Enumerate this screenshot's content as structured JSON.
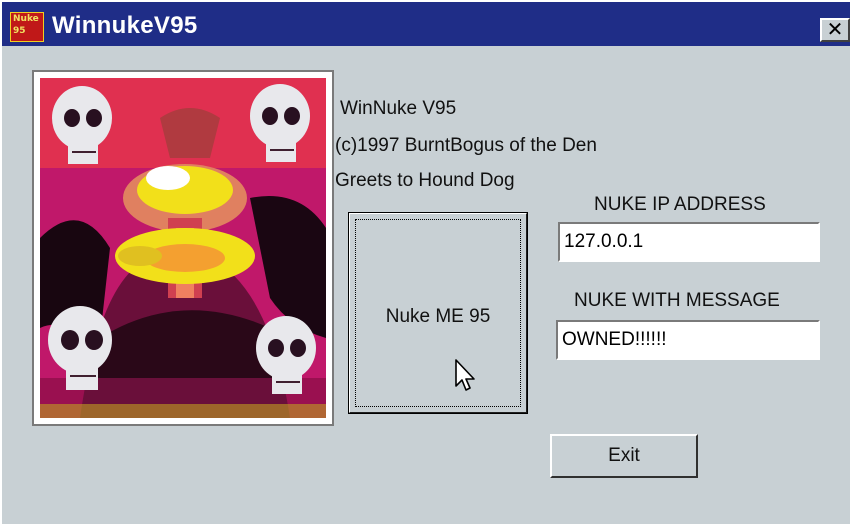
{
  "window": {
    "title": "WinnukeV95",
    "icon_text": "Nuke 95",
    "close_symbol": "✕"
  },
  "info": {
    "line1": "WinNuke V95",
    "line2": "(c)1997 BurntBogus of the Den",
    "line3": "Greets to Hound Dog"
  },
  "nuke_button": {
    "label": "Nuke ME 95"
  },
  "ip_section": {
    "label": "NUKE IP ADDRESS",
    "value": "127.0.0.1"
  },
  "message_section": {
    "label": "NUKE WITH MESSAGE",
    "value": "OWNED!!!!!!"
  },
  "exit_button": {
    "label": "Exit"
  },
  "colors": {
    "titlebar": "#1f2d87",
    "dialog_bg": "#c8d0d4",
    "art_magenta": "#c0186a",
    "art_yellow": "#f2e01a"
  },
  "icons": [
    "app-icon",
    "close-icon",
    "skull-nuke-image",
    "mouse-cursor-icon"
  ]
}
